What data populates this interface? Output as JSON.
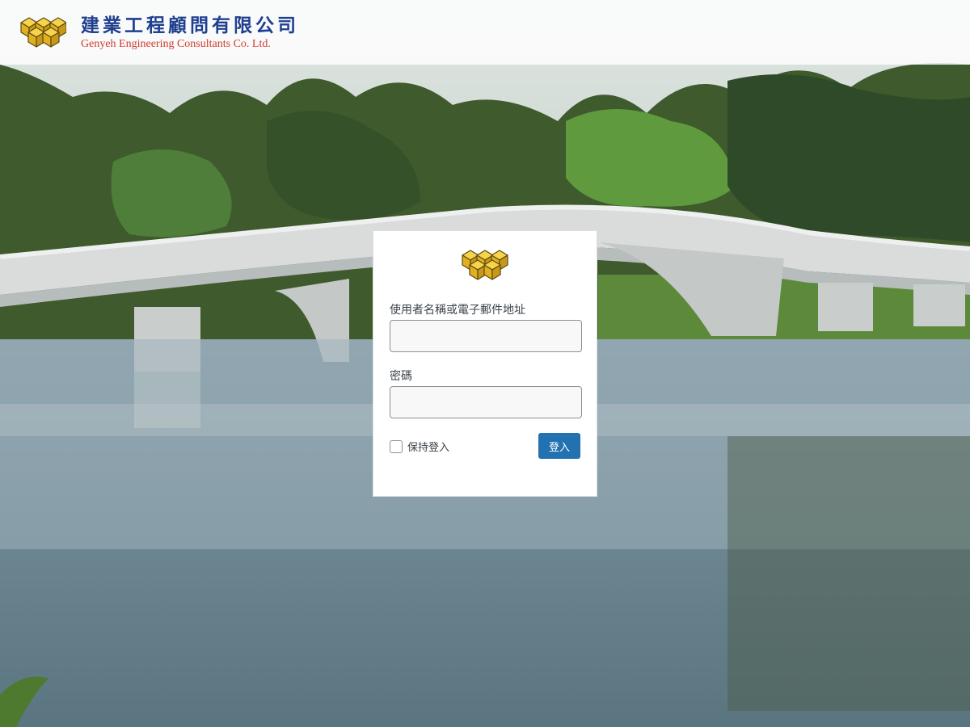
{
  "header": {
    "company_name_zh": "建業工程顧問有限公司",
    "company_name_en": "Genyeh Engineering Consultants Co. Ltd.",
    "logo_icon": "yellow-cubes-logo"
  },
  "login": {
    "logo_icon": "yellow-cubes-logo",
    "username_label": "使用者名稱或電子郵件地址",
    "username_value": "",
    "password_label": "密碼",
    "password_value": "",
    "remember_label": "保持登入",
    "remember_checked": false,
    "submit_label": "登入",
    "accent_color": "#2271b1"
  },
  "background": {
    "scene": "bridge-over-lake-photo"
  }
}
